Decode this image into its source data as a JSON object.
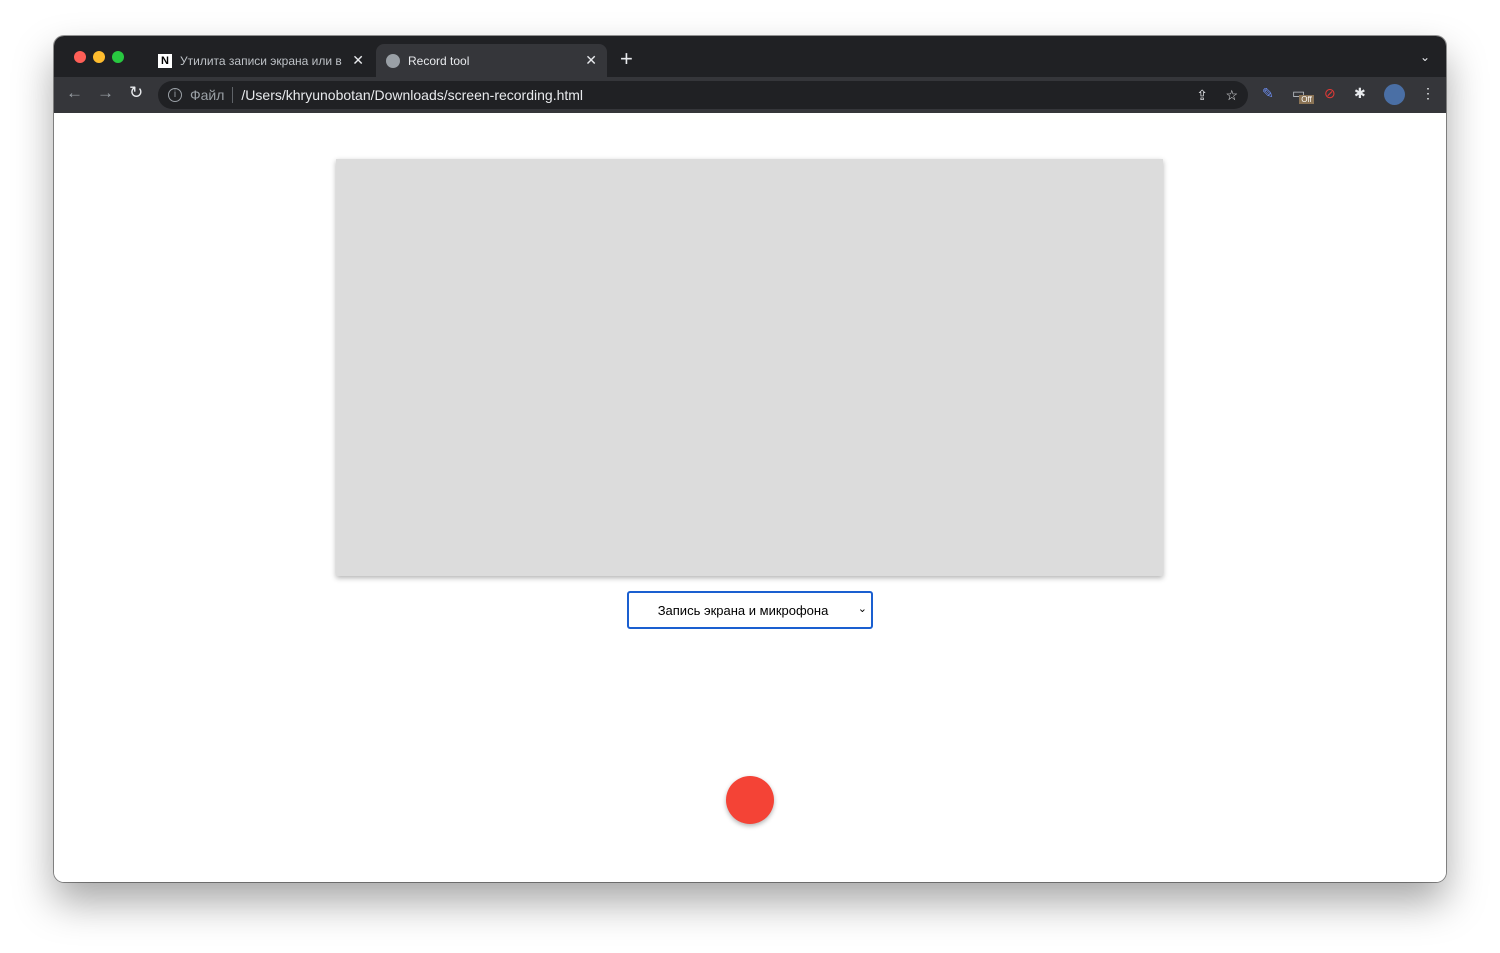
{
  "browser": {
    "tabs": [
      {
        "title": "Утилита записи экрана или в",
        "icon": "notion-icon",
        "active": false
      },
      {
        "title": "Record tool",
        "icon": "globe-icon",
        "active": true
      }
    ],
    "new_tab": "+",
    "address": {
      "scheme_label": "Файл",
      "url": "/Users/khryunobotan/Downloads/screen-recording.html"
    },
    "extension_badge": "Off"
  },
  "page": {
    "mode_select": {
      "selected": "Запись экрана и микрофона"
    },
    "record_button_color": "#f44336"
  }
}
